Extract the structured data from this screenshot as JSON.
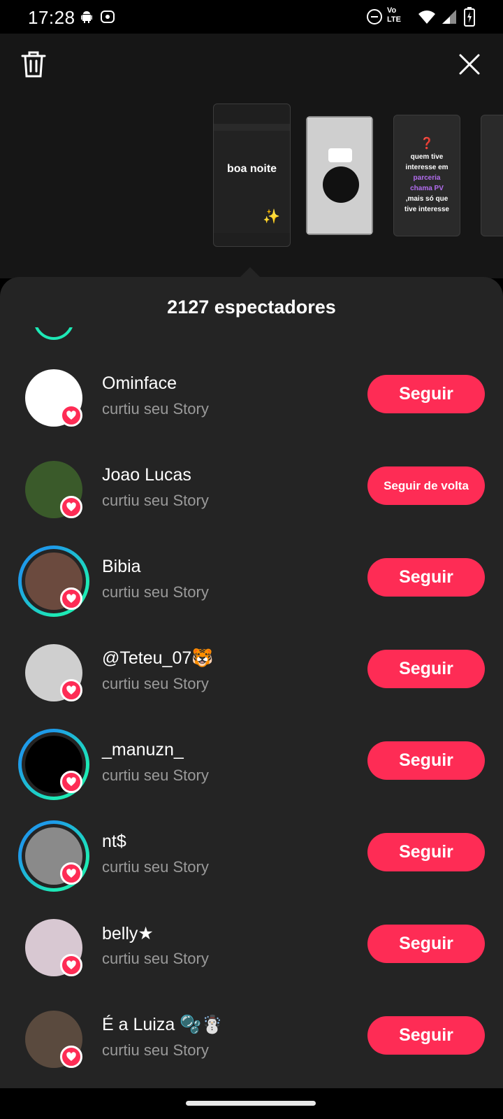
{
  "status_bar": {
    "time": "17:28",
    "icons": [
      "android-icon",
      "cast-icon",
      "dnd-icon",
      "volte-icon",
      "wifi-icon",
      "signal-icon",
      "battery-icon"
    ],
    "volte_top": "Vo",
    "volte_bottom": "LTE"
  },
  "top": {
    "delete_icon": "trash-icon",
    "close_icon": "close-icon"
  },
  "stories": [
    {
      "text": "boa noite",
      "sparkle": "✨"
    },
    {
      "text": ""
    },
    {
      "question": "❓",
      "lines": [
        "quem tive",
        "interesse em",
        "parceria",
        "chama PV",
        ",mais só que",
        "tive interesse"
      ]
    }
  ],
  "sheet": {
    "title": "2127 espectadores"
  },
  "viewers": [
    {
      "name": "Ominface",
      "subtitle": "curtiu seu Story",
      "action": "Seguir",
      "ring": false,
      "avatar_color": "#ffffff"
    },
    {
      "name": "Joao Lucas",
      "subtitle": "curtiu seu Story",
      "action": "Seguir de volta",
      "ring": false,
      "avatar_color": "#3a5a2a"
    },
    {
      "name": "Bibia",
      "subtitle": "curtiu seu Story",
      "action": "Seguir",
      "ring": true,
      "avatar_color": "#6b4a3e"
    },
    {
      "name": "@Teteu_07🐯",
      "subtitle": "curtiu seu Story",
      "action": "Seguir",
      "ring": false,
      "avatar_color": "#cfcfcf"
    },
    {
      "name": "_manuzn_",
      "subtitle": "curtiu seu Story",
      "action": "Seguir",
      "ring": true,
      "avatar_color": "#000000"
    },
    {
      "name": "nt$",
      "subtitle": "curtiu seu Story",
      "action": "Seguir",
      "ring": true,
      "avatar_color": "#8a8a8a"
    },
    {
      "name": "belly★",
      "subtitle": "curtiu seu Story",
      "action": "Seguir",
      "ring": false,
      "avatar_color": "#d8c8d2"
    },
    {
      "name": "É a Luiza 🫧☃️",
      "subtitle": "curtiu seu Story",
      "action": "Seguir",
      "ring": false,
      "avatar_color": "#5a4a3e"
    }
  ],
  "colors": {
    "accent": "#fe2c55",
    "ring_start": "#1e9be9",
    "ring_end": "#1de9b6",
    "sheet_bg": "#242424"
  }
}
